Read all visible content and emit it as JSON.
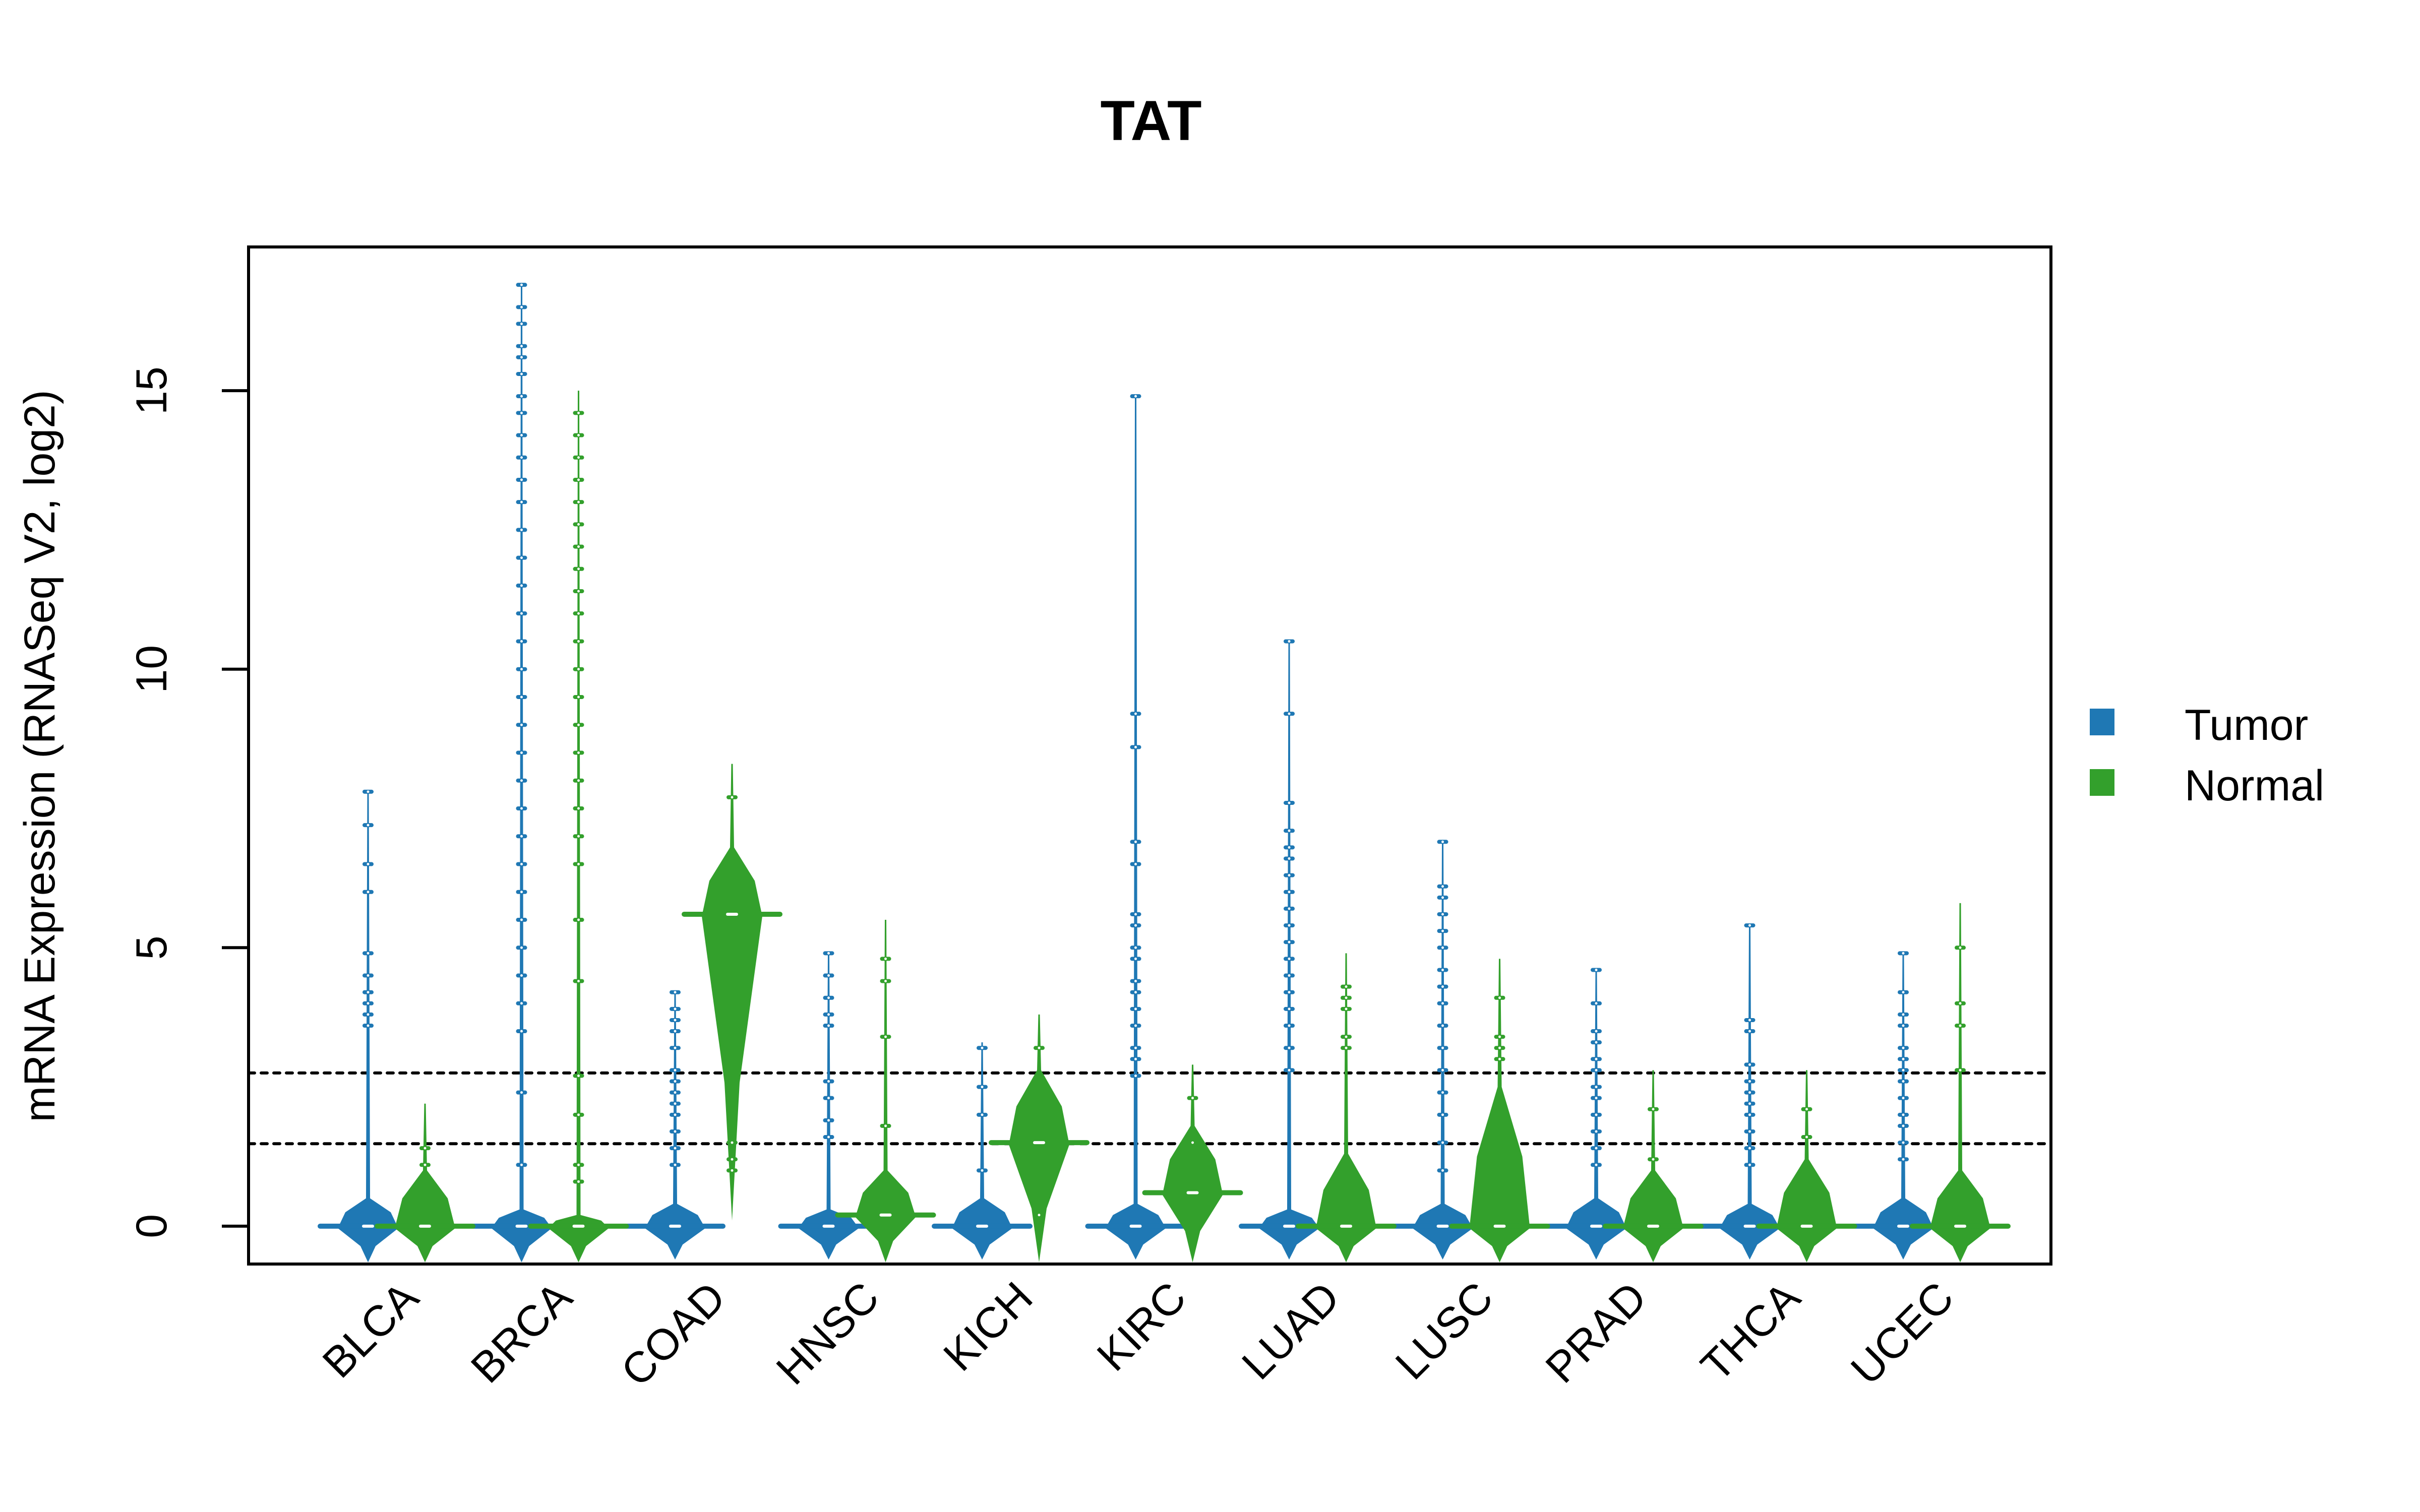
{
  "chart_data": {
    "type": "violin",
    "title": "TAT",
    "xlabel": "",
    "ylabel": "mRNA Expression (RNASeq V2, log2)",
    "ylim": [
      -0.68,
      17.58
    ],
    "yticks": [
      0,
      5,
      10,
      15
    ],
    "ytick_labels": [
      "0",
      "5",
      "10",
      "15"
    ],
    "grid": false,
    "reference_lines": [
      {
        "y": 2.75,
        "style": "dotted",
        "color": "#000000"
      },
      {
        "y": 1.48,
        "style": "dotted",
        "color": "#000000"
      }
    ],
    "categories": [
      "BLCA",
      "BRCA",
      "COAD",
      "HNSC",
      "KICH",
      "KIRC",
      "LUAD",
      "LUSC",
      "PRAD",
      "THCA",
      "UCEC"
    ],
    "legend": {
      "position": "right",
      "entries": [
        {
          "label": "Tumor",
          "color": "#1f78b4"
        },
        {
          "label": "Normal",
          "color": "#33a02c"
        }
      ]
    },
    "series": [
      {
        "name": "Tumor",
        "color": "#1f78b4",
        "groups": [
          {
            "category": "BLCA",
            "min": -0.65,
            "median": 0,
            "max": 7.8,
            "bulk_top": 0.5,
            "outliers": [
              7.8,
              7.2,
              6.5,
              6.0,
              4.9,
              4.5,
              4.2,
              4.0,
              3.8,
              3.6
            ]
          },
          {
            "category": "BRCA",
            "min": -0.65,
            "median": 0,
            "max": 16.9,
            "bulk_top": 0.3,
            "outliers": [
              16.9,
              16.5,
              16.2,
              15.8,
              15.6,
              15.3,
              14.9,
              14.6,
              14.2,
              13.8,
              13.4,
              13.0,
              12.5,
              12.0,
              11.5,
              11.0,
              10.5,
              10.0,
              9.5,
              9.0,
              8.5,
              8.0,
              7.5,
              7.0,
              6.5,
              6.0,
              5.5,
              5.0,
              4.5,
              4.0,
              3.5,
              2.4,
              1.1
            ]
          },
          {
            "category": "COAD",
            "min": -0.6,
            "median": 0,
            "max": 4.2,
            "bulk_top": 0.4,
            "outliers": [
              4.2,
              3.9,
              3.7,
              3.5,
              3.2,
              2.8,
              2.6,
              2.4,
              2.2,
              2.0,
              1.7,
              1.4,
              1.1
            ]
          },
          {
            "category": "HNSC",
            "min": -0.6,
            "median": 0,
            "max": 4.9,
            "bulk_top": 0.3,
            "outliers": [
              4.9,
              4.5,
              4.1,
              3.8,
              3.6,
              2.6,
              2.3,
              1.9,
              1.6
            ]
          },
          {
            "category": "KICH",
            "min": -0.6,
            "median": 0,
            "max": 3.3,
            "bulk_top": 0.5,
            "outliers": [
              3.2,
              2.5,
              2.0,
              1.0
            ]
          },
          {
            "category": "KIRC",
            "min": -0.6,
            "median": 0,
            "max": 14.9,
            "bulk_top": 0.4,
            "outliers": [
              14.9,
              9.2,
              8.6,
              6.9,
              6.5,
              5.6,
              5.4,
              5.0,
              4.8,
              4.4,
              4.2,
              3.9,
              3.6,
              3.2,
              3.0,
              2.7
            ]
          },
          {
            "category": "LUAD",
            "min": -0.6,
            "median": 0,
            "max": 10.5,
            "bulk_top": 0.3,
            "outliers": [
              10.5,
              9.2,
              7.6,
              7.1,
              6.8,
              6.6,
              6.3,
              6.0,
              5.7,
              5.4,
              5.1,
              4.8,
              4.5,
              4.2,
              3.9,
              3.6,
              3.2,
              2.8
            ]
          },
          {
            "category": "LUSC",
            "min": -0.6,
            "median": 0,
            "max": 6.9,
            "bulk_top": 0.4,
            "outliers": [
              6.9,
              6.1,
              5.9,
              5.6,
              5.3,
              5.0,
              4.6,
              4.3,
              4.0,
              3.6,
              3.2,
              2.8,
              2.4,
              2.0,
              1.5,
              1.0
            ]
          },
          {
            "category": "PRAD",
            "min": -0.6,
            "median": 0,
            "max": 4.6,
            "bulk_top": 0.5,
            "outliers": [
              4.6,
              4.0,
              3.5,
              3.3,
              3.0,
              2.8,
              2.5,
              2.3,
              2.0,
              1.7,
              1.4,
              1.1
            ]
          },
          {
            "category": "THCA",
            "min": -0.6,
            "median": 0,
            "max": 5.4,
            "bulk_top": 0.4,
            "outliers": [
              5.4,
              3.7,
              3.5,
              2.9,
              2.6,
              2.4,
              2.2,
              2.0,
              1.7,
              1.4,
              1.1
            ]
          },
          {
            "category": "UCEC",
            "min": -0.6,
            "median": 0,
            "max": 4.9,
            "bulk_top": 0.5,
            "outliers": [
              4.9,
              4.2,
              3.8,
              3.6,
              3.2,
              3.0,
              2.8,
              2.6,
              2.3,
              2.0,
              1.8,
              1.5,
              1.2
            ]
          }
        ]
      },
      {
        "name": "Normal",
        "color": "#33a02c",
        "groups": [
          {
            "category": "BLCA",
            "min": -0.65,
            "median": 0,
            "max": 2.2,
            "bulk_top": 1.0,
            "outliers": [
              1.4,
              1.1
            ]
          },
          {
            "category": "BRCA",
            "min": -0.65,
            "median": 0,
            "max": 15.0,
            "bulk_top": 0.2,
            "outliers": [
              14.6,
              14.2,
              13.8,
              13.4,
              13.0,
              12.6,
              12.2,
              11.8,
              11.4,
              11.0,
              10.5,
              10.0,
              9.5,
              9.0,
              8.5,
              8.0,
              7.5,
              7.0,
              6.5,
              5.5,
              4.4,
              2.7,
              2.0,
              1.1,
              0.8
            ]
          },
          {
            "category": "COAD",
            "min": 0.1,
            "median": 5.6,
            "max": 8.3,
            "bulk_top": 6.8,
            "outliers": [
              7.7,
              1.5,
              1.2,
              1.0
            ]
          },
          {
            "category": "HNSC",
            "min": -0.65,
            "median": 0.2,
            "max": 5.5,
            "bulk_top": 1.0,
            "outliers": [
              4.8,
              4.4,
              3.4,
              1.8
            ]
          },
          {
            "category": "KICH",
            "min": -0.65,
            "median": 1.5,
            "max": 3.8,
            "bulk_top": 2.8,
            "outliers": [
              3.2,
              0.2
            ]
          },
          {
            "category": "KIRC",
            "min": -0.65,
            "median": 0.6,
            "max": 2.9,
            "bulk_top": 1.8,
            "outliers": [
              2.3,
              1.5
            ]
          },
          {
            "category": "LUAD",
            "min": -0.65,
            "median": 0,
            "max": 4.9,
            "bulk_top": 1.3,
            "outliers": [
              4.3,
              4.1,
              3.9,
              3.4,
              3.2
            ]
          },
          {
            "category": "LUSC",
            "min": -0.65,
            "median": 0,
            "max": 4.8,
            "bulk_top": 2.5,
            "outliers": [
              4.1,
              3.4,
              3.2,
              3.0
            ]
          },
          {
            "category": "PRAD",
            "min": -0.65,
            "median": 0,
            "max": 2.8,
            "bulk_top": 1.0,
            "outliers": [
              2.1,
              1.2
            ]
          },
          {
            "category": "THCA",
            "min": -0.65,
            "median": 0,
            "max": 2.8,
            "bulk_top": 1.2,
            "outliers": [
              2.1,
              1.6
            ]
          },
          {
            "category": "UCEC",
            "min": -0.65,
            "median": 0,
            "max": 5.8,
            "bulk_top": 1.0,
            "outliers": [
              5.0,
              4.0,
              3.6,
              2.8
            ]
          }
        ]
      }
    ]
  }
}
